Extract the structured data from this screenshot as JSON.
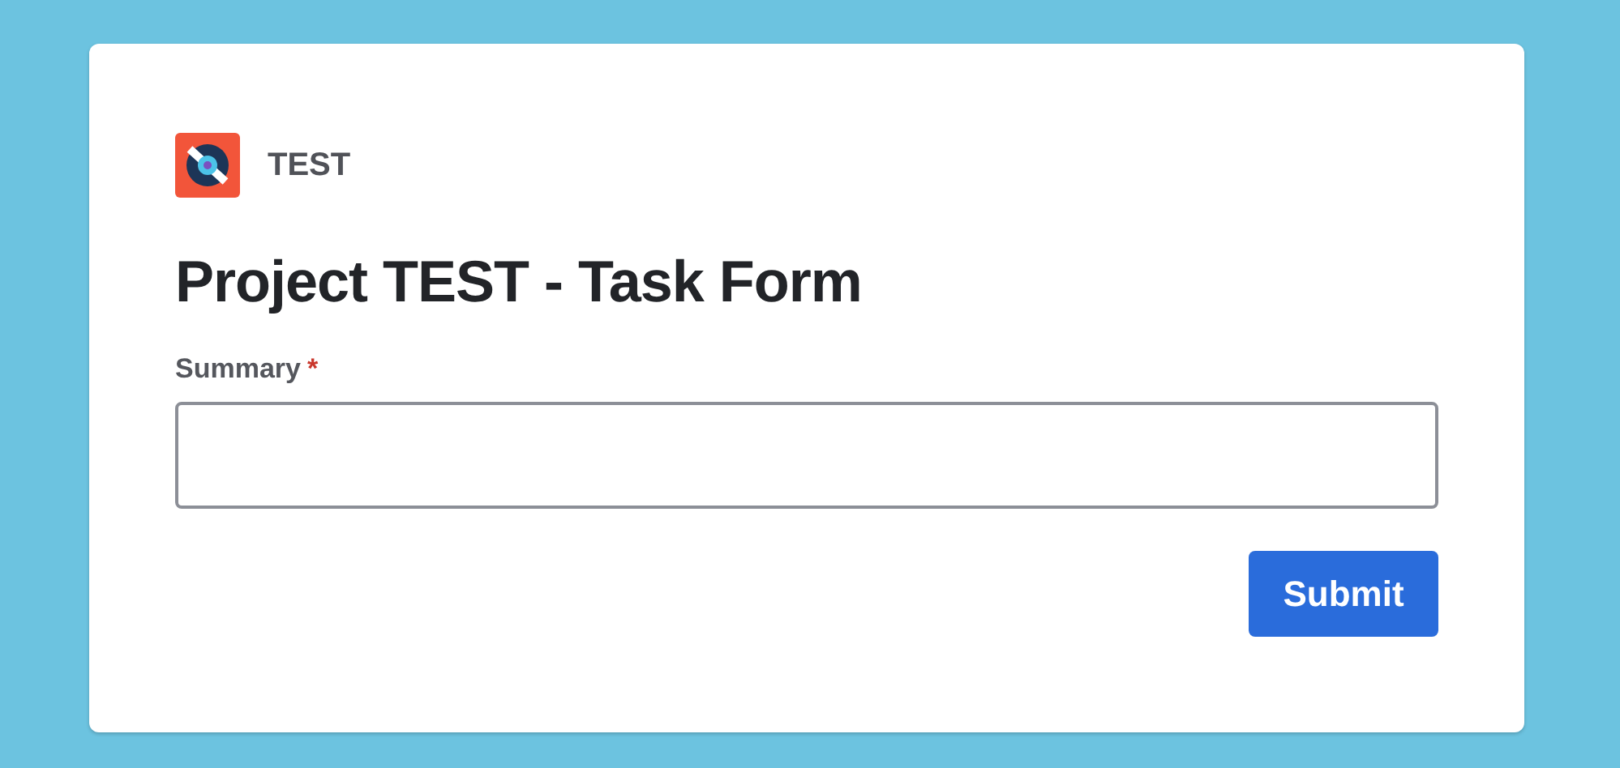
{
  "project": {
    "name": "TEST"
  },
  "form": {
    "title": "Project TEST - Task Form",
    "fields": [
      {
        "label": "Summary",
        "required_mark": "*"
      }
    ],
    "buttons": [
      "Submit"
    ]
  }
}
